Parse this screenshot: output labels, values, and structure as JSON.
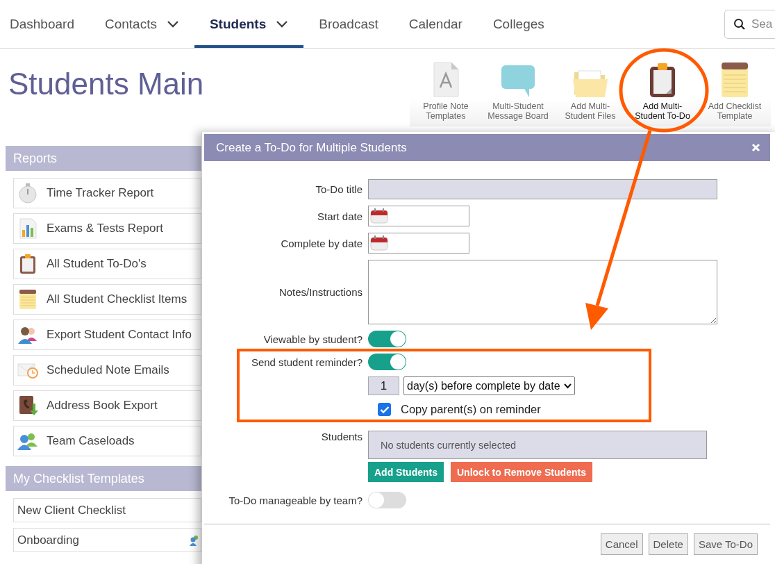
{
  "nav": {
    "items": [
      {
        "label": "Dashboard",
        "selected": false,
        "dropdown": false
      },
      {
        "label": "Contacts",
        "selected": false,
        "dropdown": true
      },
      {
        "label": "Students",
        "selected": true,
        "dropdown": true
      },
      {
        "label": "Broadcast",
        "selected": false,
        "dropdown": false
      },
      {
        "label": "Calendar",
        "selected": false,
        "dropdown": false
      },
      {
        "label": "Colleges",
        "selected": false,
        "dropdown": false
      }
    ],
    "search": {
      "placeholder": "Sea"
    }
  },
  "page_title": "Students Main",
  "toolbar": [
    {
      "label": "Profile Note Templates",
      "kind": "document",
      "selected": false
    },
    {
      "label": "Multi-Student Message Board",
      "kind": "bubble",
      "selected": false
    },
    {
      "label": "Add Multi-Student Files",
      "kind": "folder",
      "selected": false
    },
    {
      "label": "Add Multi-Student To-Do",
      "kind": "clipboard",
      "selected": true
    },
    {
      "label": "Add Checklist Template",
      "kind": "notepad",
      "selected": false
    }
  ],
  "sidebar": [
    {
      "title": "Reports",
      "items": [
        {
          "label": "Time Tracker Report",
          "kind": "stopwatch"
        },
        {
          "label": "Exams & Tests Report",
          "kind": "chart"
        },
        {
          "label": "All Student To-Do's",
          "kind": "clipboard"
        },
        {
          "label": "All Student Checklist Items",
          "kind": "notepad"
        },
        {
          "label": "Export Student Contact Info",
          "kind": "contacts"
        },
        {
          "label": "Scheduled Note Emails",
          "kind": "mail"
        },
        {
          "label": "Address Book Export",
          "kind": "addressbook"
        },
        {
          "label": "Team Caseloads",
          "kind": "team"
        }
      ]
    },
    {
      "title": "My Checklist Templates",
      "items": [
        {
          "label": "New Client Checklist",
          "kind": "none"
        },
        {
          "label": "Onboarding",
          "kind": "shared"
        }
      ]
    }
  ],
  "modal": {
    "title": "Create a To-Do for Multiple Students",
    "todo_title": {
      "label": "To-Do title"
    },
    "start_date": {
      "label": "Start date"
    },
    "complete_date": {
      "label": "Complete by date"
    },
    "notes": {
      "label": "Notes/Instructions"
    },
    "viewable": {
      "label": "Viewable by student?",
      "on": true
    },
    "reminder": {
      "label": "Send student reminder?",
      "on": true,
      "days": "1",
      "unit": "day(s) before complete by date",
      "copy_label": "Copy parent(s) on reminder",
      "copy_checked": true
    },
    "students": {
      "label": "Students",
      "empty_text": "No students currently selected",
      "add_button": "Add Students",
      "unlock_button": "Unlock to Remove Students"
    },
    "manageable": {
      "label": "To-Do manageable by team?",
      "on": false
    },
    "buttons": [
      "Cancel",
      "Delete",
      "Save To-Do"
    ]
  }
}
